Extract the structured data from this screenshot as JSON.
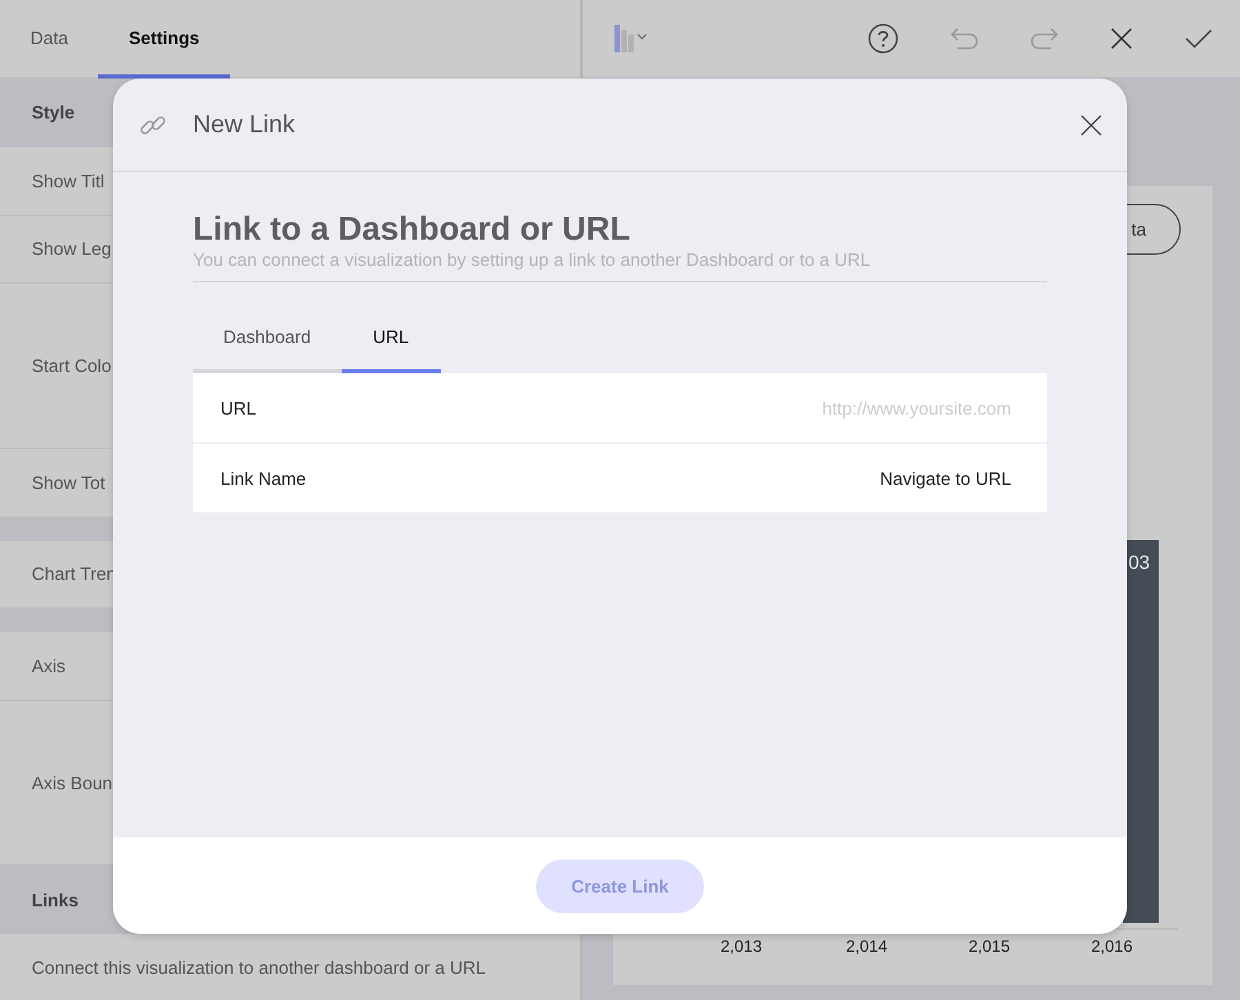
{
  "left_panel": {
    "tabs": [
      {
        "label": "Data",
        "selected": false
      },
      {
        "label": "Settings",
        "selected": true
      }
    ],
    "settings": [
      {
        "kind": "section",
        "label": "Style"
      },
      {
        "kind": "row",
        "label": "Show Titl"
      },
      {
        "kind": "row",
        "label": "Show Leg"
      },
      {
        "kind": "tall",
        "label": "Start Colo"
      },
      {
        "kind": "row",
        "label": "Show Tot"
      },
      {
        "kind": "spacer"
      },
      {
        "kind": "row",
        "label": "Chart Tren"
      },
      {
        "kind": "spacer"
      },
      {
        "kind": "row",
        "label": "Axis"
      },
      {
        "kind": "tall",
        "label": "Axis Boun"
      },
      {
        "kind": "section",
        "label": "Links"
      },
      {
        "kind": "description",
        "label": "Connect this visualization to another dashboard or a URL"
      }
    ]
  },
  "chart": {
    "button_label": "ta",
    "bar_label": "03",
    "x_labels": [
      "2,013",
      "2,014",
      "2,015",
      "2,016"
    ]
  },
  "dialog": {
    "title": "New Link",
    "heading": "Link to a Dashboard or URL",
    "subtitle": "You can connect a visualization by setting up a link to another Dashboard or to a URL",
    "tabs": [
      {
        "label": "Dashboard",
        "selected": false
      },
      {
        "label": "URL",
        "selected": true
      }
    ],
    "fields": [
      {
        "label": "URL",
        "placeholder": "http://www.yoursite.com"
      },
      {
        "label": "Link Name",
        "value": "Navigate to URL"
      }
    ],
    "create_button": {
      "label": "Create Link",
      "disabled": true
    }
  }
}
